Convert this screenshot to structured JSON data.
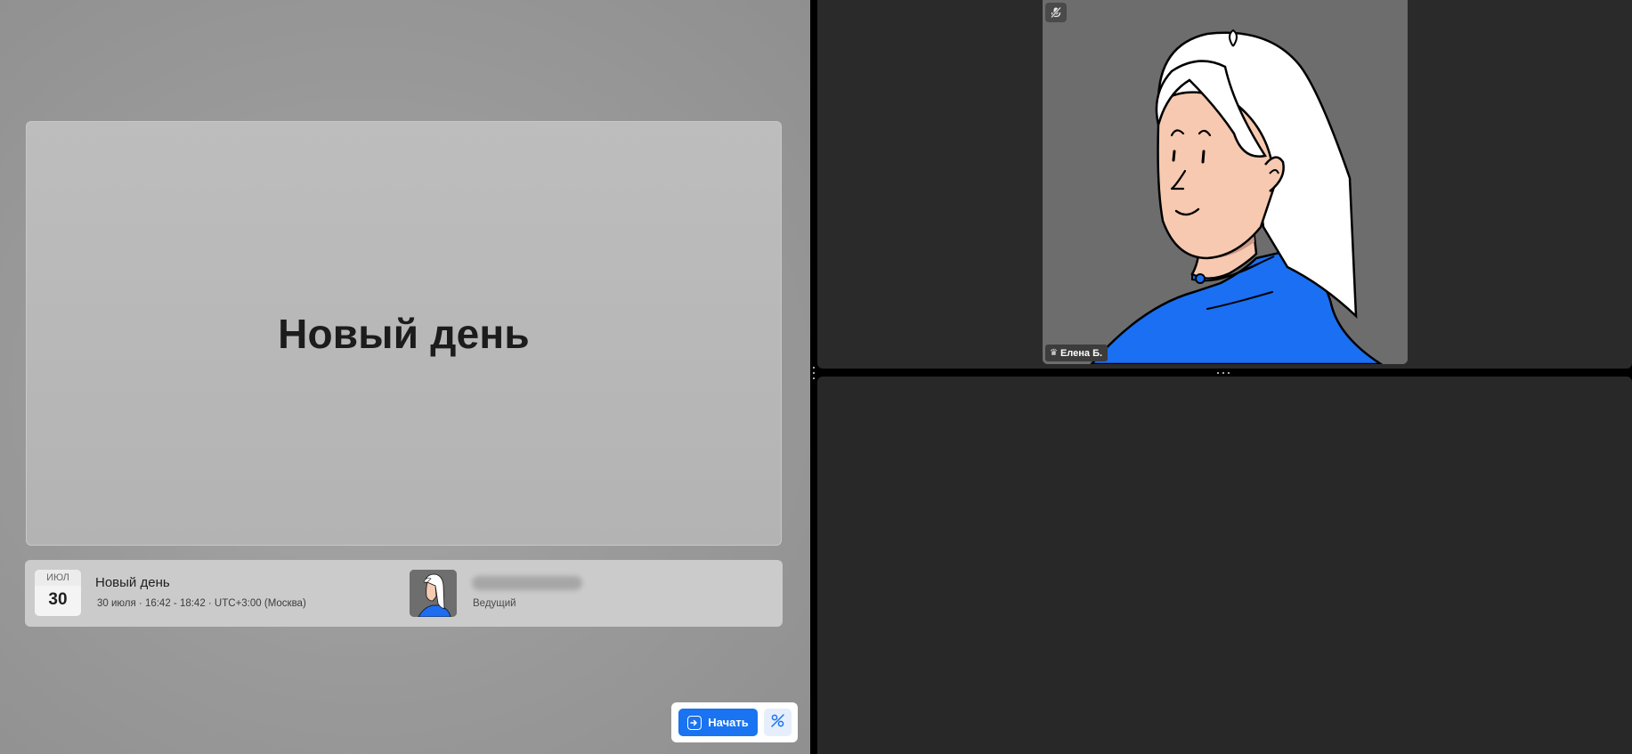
{
  "slide": {
    "title": "Новый день"
  },
  "event": {
    "month": "ИЮЛ",
    "day": "30",
    "title": "Новый день",
    "time": "30 июля · 16:42 - 18:42 · UTC+3:00 (Москва)",
    "host_role": "Ведущий"
  },
  "controls": {
    "start_label": "Начать"
  },
  "participant": {
    "name": "Елена Б."
  },
  "colors": {
    "accent": "#1a73f0",
    "tile_bg": "#2a2a2a",
    "video_bg": "#6d6d6d"
  },
  "icons": {
    "start": "enter-icon",
    "settings": "settings-icon",
    "mute": "mic-off-icon",
    "host": "crown-icon"
  }
}
